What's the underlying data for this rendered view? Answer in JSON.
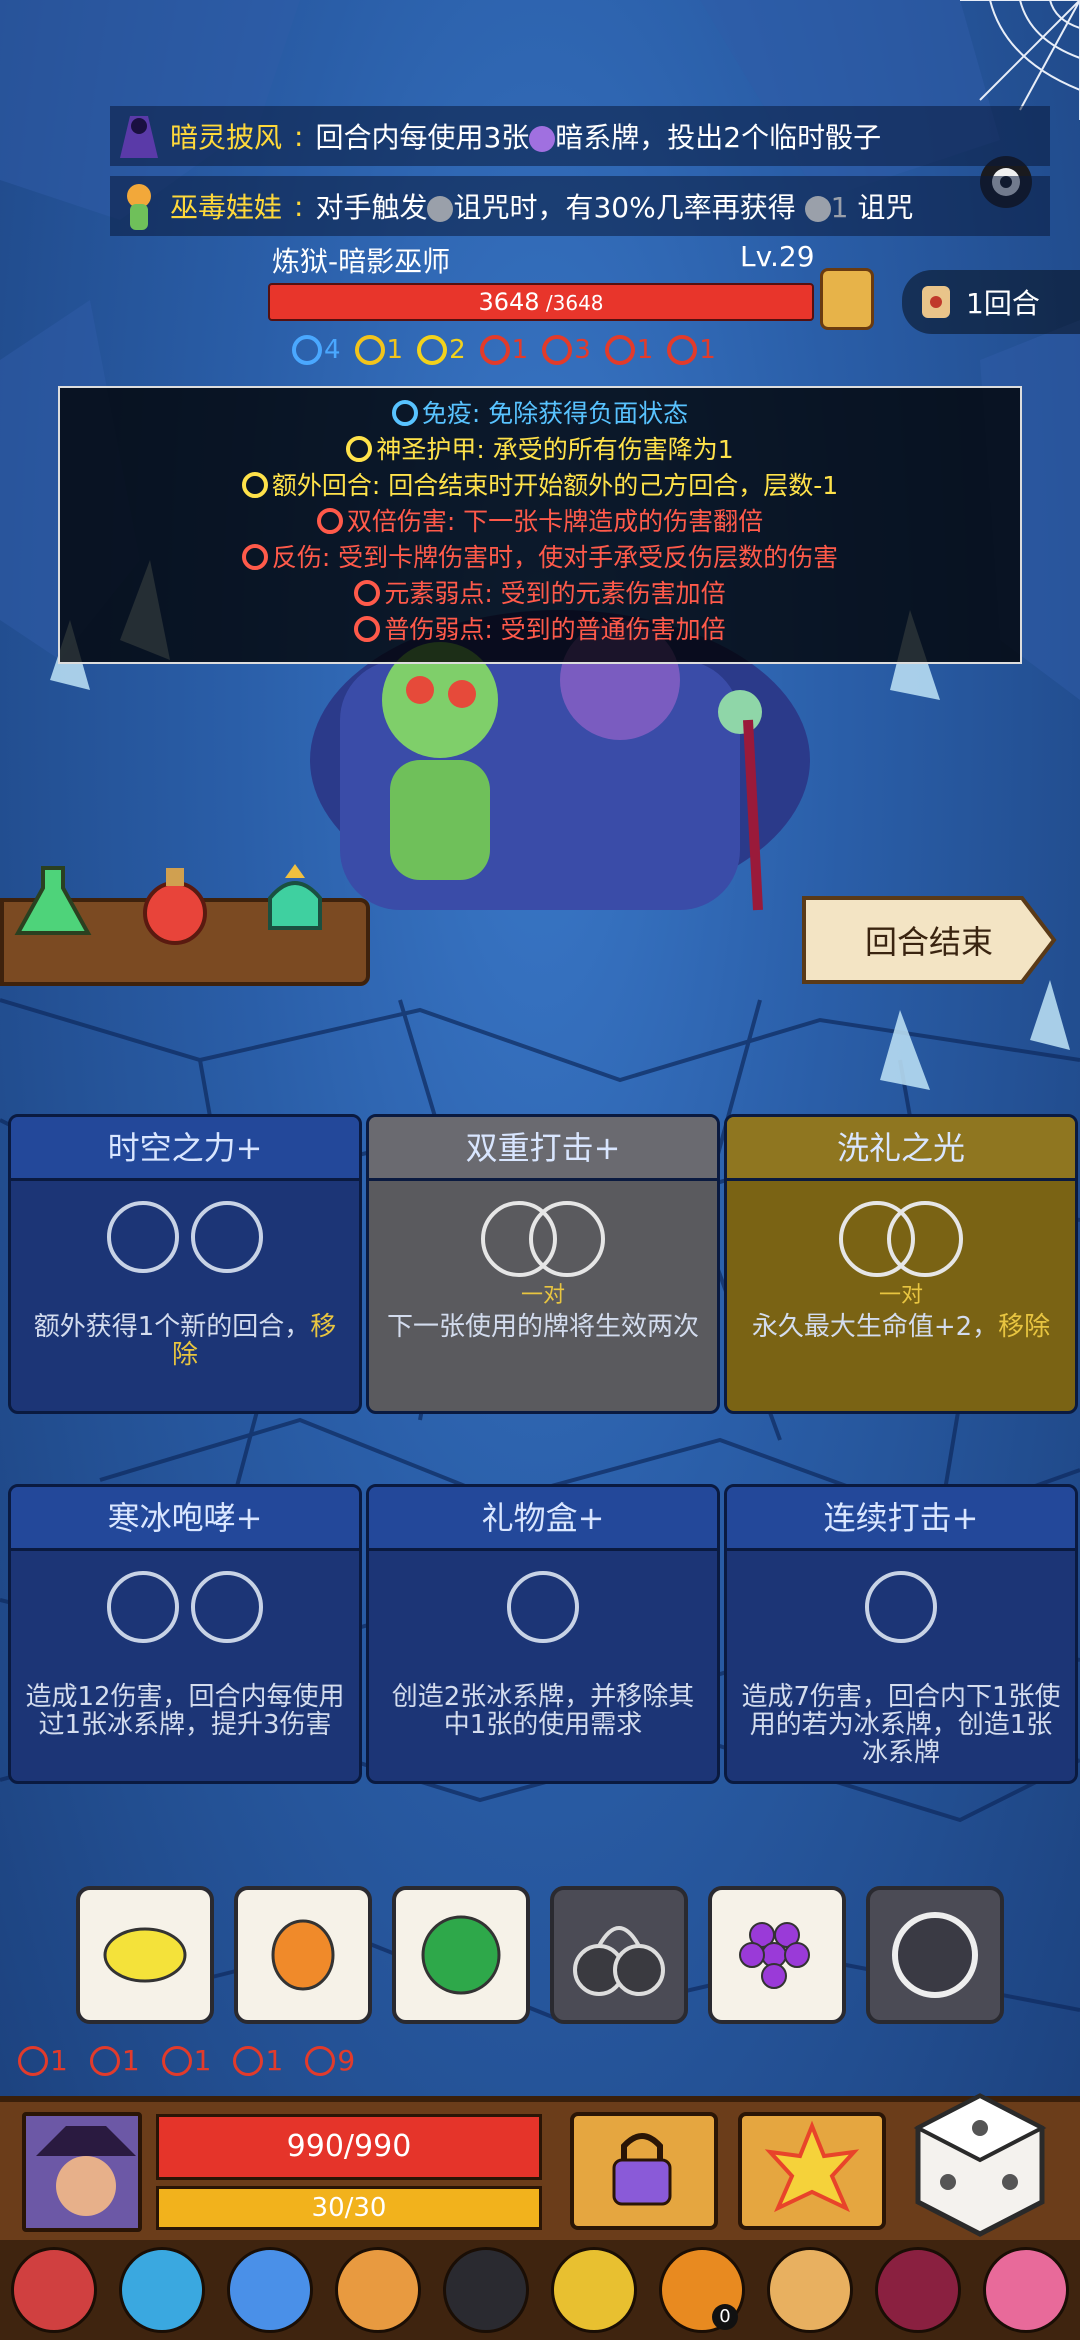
{
  "passives": [
    {
      "name": "暗灵披风",
      "desc_pre": "回合内每使用3张",
      "desc_post": "暗系牌，投出2个临时骰子"
    },
    {
      "name": "巫毒娃娃",
      "desc_pre": "对手触发",
      "desc_mid": "诅咒时，有30%几率再获得",
      "desc_num": "1",
      "desc_post": "诅咒"
    }
  ],
  "enemy": {
    "name": "炼狱-暗影巫师",
    "level": "Lv.29",
    "hp_current": "3648",
    "hp_max": " /3648",
    "statuses": [
      {
        "icon": "immunity-icon",
        "count": "4",
        "color": "#4aa8ff"
      },
      {
        "icon": "holy-armor-icon",
        "count": "1",
        "color": "#f2c41c"
      },
      {
        "icon": "extra-turn-icon",
        "count": "2",
        "color": "#f2d21c"
      },
      {
        "icon": "double-damage-icon",
        "count": "1",
        "color": "#e23b2b"
      },
      {
        "icon": "reflect-icon",
        "count": "3",
        "color": "#e23b2b"
      },
      {
        "icon": "element-weakness-icon",
        "count": "1",
        "color": "#e23b2b"
      },
      {
        "icon": "physical-weakness-icon",
        "count": "1",
        "color": "#e23b2b"
      }
    ]
  },
  "round": {
    "label": "1回合"
  },
  "tooltip": [
    {
      "text": "免疫: 免除获得负面状态",
      "color": "#58c3ff",
      "icon": "immunity-icon"
    },
    {
      "text": "神圣护甲: 承受的所有伤害降为1",
      "color": "#ffe24a",
      "icon": "holy-armor-icon"
    },
    {
      "text": "额外回合: 回合结束时开始额外的己方回合，层数-1",
      "color": "#ffe24a",
      "icon": "extra-turn-icon"
    },
    {
      "text": "双倍伤害: 下一张卡牌造成的伤害翻倍",
      "color": "#ff5a4a",
      "icon": "double-damage-icon"
    },
    {
      "text": "反伤: 受到卡牌伤害时，使对手承受反伤层数的伤害",
      "color": "#ff5a4a",
      "icon": "reflect-icon"
    },
    {
      "text": "元素弱点: 受到的元素伤害加倍",
      "color": "#ff5a4a",
      "icon": "element-weakness-icon"
    },
    {
      "text": "普伤弱点: 受到的普通伤害加倍",
      "color": "#ff5a4a",
      "icon": "physical-weakness-icon"
    }
  ],
  "end_turn": "回合结束",
  "cards": [
    {
      "title": "时空之力+",
      "style": "blue",
      "slots": 2,
      "pair": false,
      "desc": "额外获得1个新的回合，",
      "remove": "移除"
    },
    {
      "title": "双重打击+",
      "style": "gray",
      "slots": 0,
      "pair": true,
      "pair_label": "一对",
      "desc": "下一张使用的牌将生效两次",
      "remove": ""
    },
    {
      "title": "洗礼之光",
      "style": "gold",
      "slots": 0,
      "pair": true,
      "pair_label": "一对",
      "desc": "永久最大生命值+2，",
      "remove": "移除"
    },
    {
      "title": "寒冰咆哮+",
      "style": "blue",
      "slots": 2,
      "pair": false,
      "desc": "造成12伤害，回合内每使用过1张冰系牌，提升3伤害",
      "remove": ""
    },
    {
      "title": "礼物盒+",
      "style": "blue",
      "slots": 1,
      "pair": false,
      "desc": "创造2张冰系牌，并移除其中1张的使用需求",
      "remove": ""
    },
    {
      "title": "连续打击+",
      "style": "blue",
      "slots": 1,
      "pair": false,
      "desc": "造成7伤害，回合内下1张使用的若为冰系牌，创造1张冰系牌",
      "remove": ""
    }
  ],
  "dice": [
    "lemon-icon",
    "orange-icon",
    "watermelon-icon",
    "cherry-icon",
    "grape-icon",
    "dark-orb-icon"
  ],
  "player_statuses": [
    {
      "icon": "element-weakness-icon",
      "count": "1"
    },
    {
      "icon": "shield-break-icon",
      "count": "1"
    },
    {
      "icon": "spiral-icon",
      "count": "1"
    },
    {
      "icon": "physical-weakness-icon",
      "count": "1"
    },
    {
      "icon": "burn-icon",
      "count": "9"
    }
  ],
  "player": {
    "hp": "990/990",
    "mp": "30/30"
  },
  "relics": [
    {
      "icon": "ring-icon",
      "count": ""
    },
    {
      "icon": "ice-gem-icon",
      "count": ""
    },
    {
      "icon": "ice-crystal-icon",
      "count": ""
    },
    {
      "icon": "eye-orb-icon",
      "count": ""
    },
    {
      "icon": "dark-wing-icon",
      "count": ""
    },
    {
      "icon": "rune-icon",
      "count": ""
    },
    {
      "icon": "golden-mask-icon",
      "count": "0"
    },
    {
      "icon": "spiked-die-icon",
      "count": ""
    },
    {
      "icon": "cursed-cloak-icon",
      "count": ""
    },
    {
      "icon": "pink-egg-icon",
      "count": ""
    }
  ]
}
